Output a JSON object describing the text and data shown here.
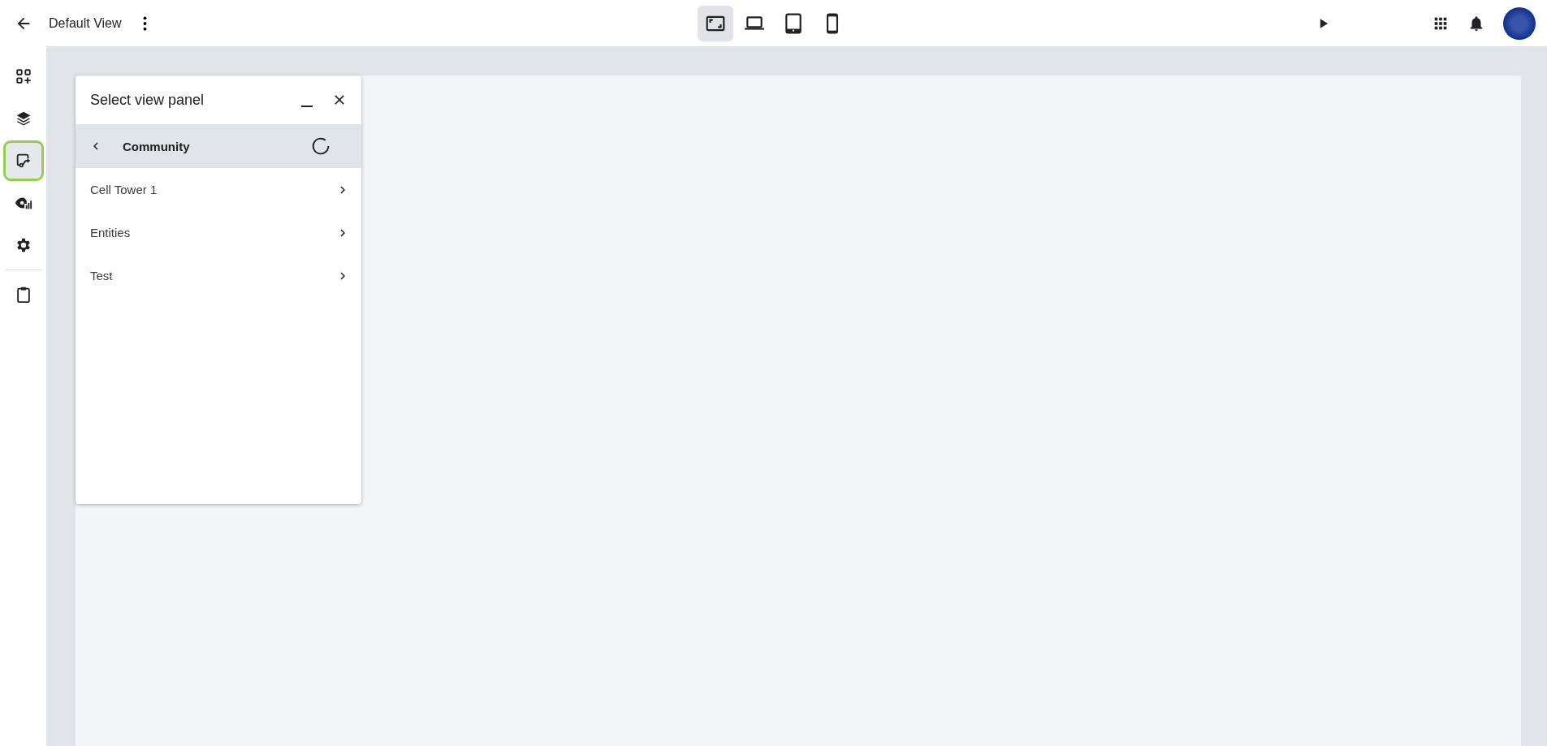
{
  "top_bar": {
    "title": "Default View",
    "device_views": [
      {
        "kind": "fit",
        "selected": true
      },
      {
        "kind": "laptop",
        "selected": false
      },
      {
        "kind": "tablet",
        "selected": false
      },
      {
        "kind": "phone",
        "selected": false
      }
    ]
  },
  "sidebar": {
    "items": [
      {
        "kind": "widgets",
        "selected": false
      },
      {
        "kind": "layers",
        "selected": false
      },
      {
        "kind": "route",
        "selected": true
      },
      {
        "kind": "visibility",
        "selected": false
      },
      {
        "kind": "settings",
        "selected": false
      },
      {
        "kind": "clipboard",
        "selected": false
      }
    ]
  },
  "panel": {
    "title": "Select view panel",
    "breadcrumb": {
      "label": "Community",
      "loading": true
    },
    "items": [
      {
        "label": "Cell Tower 1"
      },
      {
        "label": "Entities"
      },
      {
        "label": "Test"
      }
    ]
  }
}
